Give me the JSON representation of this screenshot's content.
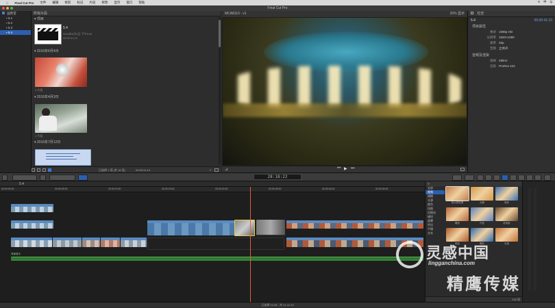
{
  "menubar": {
    "items": [
      "Final Cut Pro",
      "文件",
      "编辑",
      "修剪",
      "标记",
      "片段",
      "修改",
      "显示",
      "窗口",
      "帮助"
    ],
    "right": [
      "S",
      "中",
      "Q"
    ]
  },
  "window": {
    "title": "Final Cut Pro"
  },
  "libraries": {
    "root": "国笑堂",
    "items": [
      "5.1",
      "5.2",
      "5.3",
      "5.4"
    ],
    "selected_index": 3
  },
  "browser": {
    "header": "所有片段",
    "groups": [
      {
        "date": "项目",
        "clip_title": "5.4",
        "clip_meta_1": "2016年6月4日 下午5:05",
        "clip_meta_2": "00:00:41:10"
      },
      {
        "date": "2016年6月4日",
        "clip_meta": "3 片段"
      },
      {
        "date": "2016年4月3日",
        "clip_meta": "1 片段"
      },
      {
        "date": "2016年7月12日",
        "clip_meta": ""
      }
    ],
    "footer_selection": "已选择 1 项 (共 18 项)",
    "footer_time": "00:00:41:10",
    "footer_right": "2"
  },
  "viewer": {
    "clip_name": "MCA8110 - v1",
    "zoom": "20%",
    "view_menu": "显示"
  },
  "inspector": {
    "header": "检查",
    "title": "5.4",
    "timecode": "00:00:41:10",
    "section_1": "项目属性",
    "rows_1": [
      {
        "k": "格式",
        "v": "1080p HD"
      },
      {
        "k": "分辨率",
        "v": "1920×1080"
      },
      {
        "k": "速率",
        "v": "25p"
      },
      {
        "k": "音频",
        "v": "立体声"
      }
    ],
    "section_2": "音频及渲染",
    "rows_2": [
      {
        "k": "采样",
        "v": "48kHz"
      },
      {
        "k": "渲染",
        "v": "ProRes 422"
      }
    ]
  },
  "toolbar": {
    "timecode": "28:18:22"
  },
  "timeline": {
    "project_name": "5.4",
    "ruler_labels": [
      "00:00:00:00",
      "00:00:05:00",
      "00:00:10:00",
      "00:00:15:00",
      "00:00:20:00",
      "00:00:25:00",
      "00:00:30:00",
      "00:00:35:00",
      "00:00:40:00"
    ],
    "audio_label": "背景音乐",
    "status": "已选择 01:05 - 共 01:41:10"
  },
  "effects": {
    "categories": [
      "全部",
      "视频",
      "模糊",
      "光源",
      "颜色",
      "扭曲",
      "风格化",
      "键控",
      "遮罩",
      "怀旧",
      "平铺",
      "文本"
    ],
    "selected": 1,
    "thumbs": [
      {
        "label": "放大镜效果",
        "color": "#c27d4a"
      },
      {
        "label": "光晕",
        "color": "#d49a4a"
      },
      {
        "label": "渐变",
        "color": "#3a6fb0"
      },
      {
        "label": "暖色",
        "color": "#b8663a"
      },
      {
        "label": "冷色",
        "color": "#5a82c0"
      },
      {
        "label": "老电影",
        "color": "#6a4a30"
      },
      {
        "label": "剪影",
        "color": "#b05a2a"
      },
      {
        "label": "霓虹",
        "color": "#2a6ab0"
      },
      {
        "label": "光斑",
        "color": "#c0703a"
      }
    ],
    "footer_count": "130 项"
  },
  "watermark": {
    "line1": "灵感中国",
    "line2": "lingganchina.com",
    "line3": "精鹰传媒"
  }
}
